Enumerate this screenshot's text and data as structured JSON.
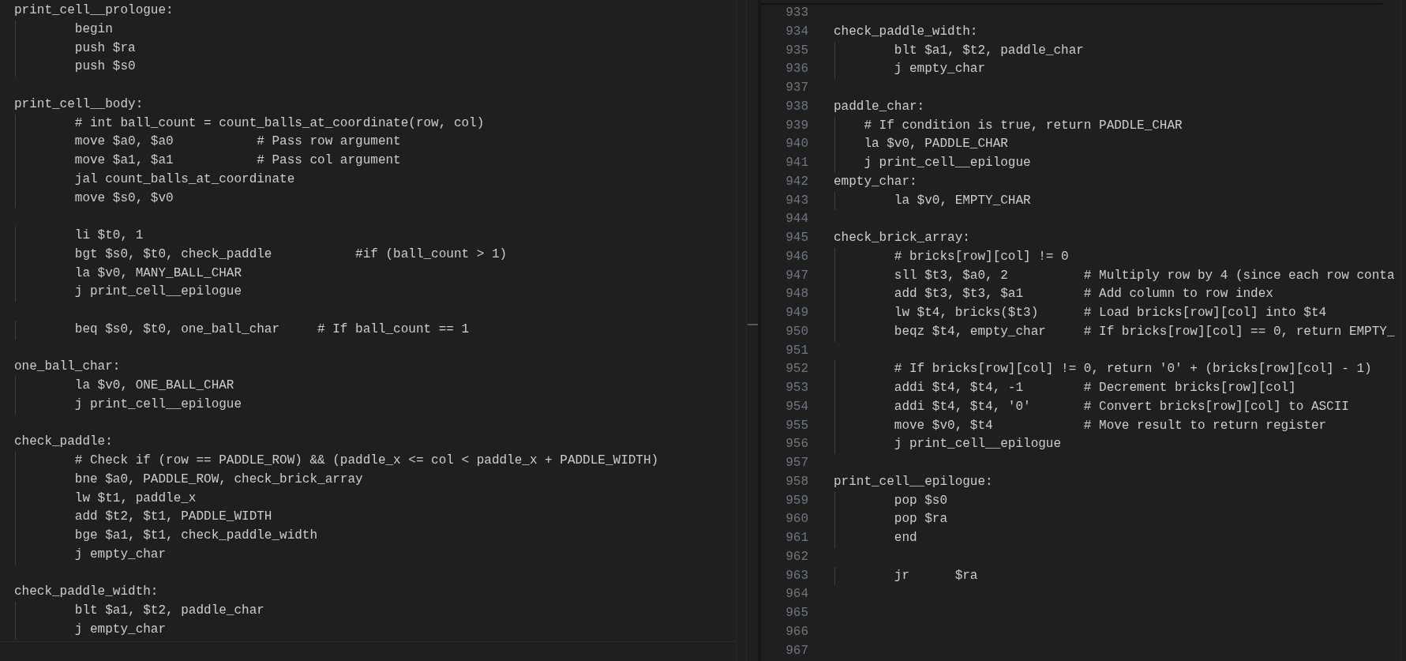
{
  "left_editor": {
    "lines": [
      {
        "kind": "code",
        "text": "print_cell__prologue:"
      },
      {
        "kind": "code",
        "text": "        begin"
      },
      {
        "kind": "code",
        "text": "        push $ra"
      },
      {
        "kind": "code",
        "text": "        push $s0"
      },
      {
        "kind": "blank"
      },
      {
        "kind": "code",
        "text": "print_cell__body:"
      },
      {
        "kind": "code",
        "text": "        # int ball_count = count_balls_at_coordinate(row, col)"
      },
      {
        "kind": "code",
        "text": "        move $a0, $a0           # Pass row argument"
      },
      {
        "kind": "code",
        "text": "        move $a1, $a1           # Pass col argument"
      },
      {
        "kind": "code",
        "text": "        jal count_balls_at_coordinate"
      },
      {
        "kind": "code",
        "text": "        move $s0, $v0"
      },
      {
        "kind": "blank"
      },
      {
        "kind": "code",
        "text": "        li $t0, 1"
      },
      {
        "kind": "code",
        "text": "        bgt $s0, $t0, check_paddle           #if (ball_count > 1)"
      },
      {
        "kind": "code",
        "text": "        la $v0, MANY_BALL_CHAR"
      },
      {
        "kind": "code",
        "text": "        j print_cell__epilogue"
      },
      {
        "kind": "blank"
      },
      {
        "kind": "code",
        "text": "        beq $s0, $t0, one_ball_char     # If ball_count == 1"
      },
      {
        "kind": "blank"
      },
      {
        "kind": "code",
        "text": "one_ball_char:"
      },
      {
        "kind": "code",
        "text": "        la $v0, ONE_BALL_CHAR"
      },
      {
        "kind": "code",
        "text": "        j print_cell__epilogue"
      },
      {
        "kind": "blank"
      },
      {
        "kind": "code",
        "text": "check_paddle:"
      },
      {
        "kind": "code",
        "text": "        # Check if (row == PADDLE_ROW) && (paddle_x <= col < paddle_x + PADDLE_WIDTH)"
      },
      {
        "kind": "code",
        "text": "        bne $a0, PADDLE_ROW, check_brick_array"
      },
      {
        "kind": "code",
        "text": "        lw $t1, paddle_x"
      },
      {
        "kind": "code",
        "text": "        add $t2, $t1, PADDLE_WIDTH"
      },
      {
        "kind": "code",
        "text": "        bge $a1, $t1, check_paddle_width"
      },
      {
        "kind": "code",
        "text": "        j empty_char"
      },
      {
        "kind": "blank"
      },
      {
        "kind": "code",
        "text": "check_paddle_width:"
      },
      {
        "kind": "code",
        "text": "        blt $a1, $t2, paddle_char"
      },
      {
        "kind": "code",
        "text": "        j empty_char"
      }
    ]
  },
  "right_editor": {
    "lines": [
      {
        "number": "933"
      },
      {
        "number": "934",
        "text": "check_paddle_width:"
      },
      {
        "number": "935",
        "text": "        blt $a1, $t2, paddle_char"
      },
      {
        "number": "936",
        "text": "        j empty_char"
      },
      {
        "number": "937"
      },
      {
        "number": "938",
        "text": "paddle_char:"
      },
      {
        "number": "939",
        "text": "    # If condition is true, return PADDLE_CHAR"
      },
      {
        "number": "940",
        "text": "    la $v0, PADDLE_CHAR"
      },
      {
        "number": "941",
        "text": "    j print_cell__epilogue"
      },
      {
        "number": "942",
        "text": "empty_char:"
      },
      {
        "number": "943",
        "text": "        la $v0, EMPTY_CHAR"
      },
      {
        "number": "944"
      },
      {
        "number": "945",
        "text": "check_brick_array:"
      },
      {
        "number": "946",
        "text": "        # bricks[row][col] != 0"
      },
      {
        "number": "947",
        "text": "        sll $t3, $a0, 2          # Multiply row by 4 (since each row conta"
      },
      {
        "number": "948",
        "text": "        add $t3, $t3, $a1        # Add column to row index"
      },
      {
        "number": "949",
        "text": "        lw $t4, bricks($t3)      # Load bricks[row][col] into $t4"
      },
      {
        "number": "950",
        "text": "        beqz $t4, empty_char     # If bricks[row][col] == 0, return EMPTY_"
      },
      {
        "number": "951"
      },
      {
        "number": "952",
        "text": "        # If bricks[row][col] != 0, return '0' + (bricks[row][col] - 1)"
      },
      {
        "number": "953",
        "text": "        addi $t4, $t4, -1        # Decrement bricks[row][col]"
      },
      {
        "number": "954",
        "text": "        addi $t4, $t4, '0'       # Convert bricks[row][col] to ASCII"
      },
      {
        "number": "955",
        "text": "        move $v0, $t4            # Move result to return register"
      },
      {
        "number": "956",
        "text": "        j print_cell__epilogue"
      },
      {
        "number": "957"
      },
      {
        "number": "958",
        "text": "print_cell__epilogue:"
      },
      {
        "number": "959",
        "text": "        pop $s0"
      },
      {
        "number": "960",
        "text": "        pop $ra"
      },
      {
        "number": "961",
        "text": "        end"
      },
      {
        "number": "962"
      },
      {
        "number": "963",
        "text": "        jr      $ra"
      },
      {
        "number": "964"
      },
      {
        "number": "965"
      },
      {
        "number": "966"
      },
      {
        "number": "967"
      }
    ]
  }
}
